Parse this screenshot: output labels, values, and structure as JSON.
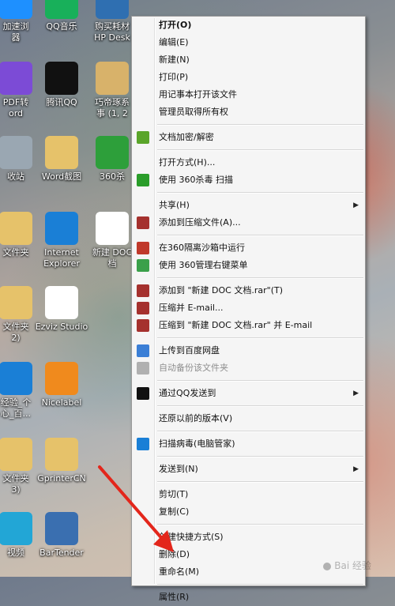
{
  "desktop": {
    "icons": [
      {
        "label": "加速浏\n器",
        "glyph": "#1e90ff"
      },
      {
        "label": "QQ音乐",
        "glyph": "#18b05a"
      },
      {
        "label": "购买耗材\nHP Desk",
        "glyph": "#2f6fb1"
      },
      {
        "label": "PDF转\nord",
        "glyph": "#7c4bd6"
      },
      {
        "label": "腾讯QQ",
        "glyph": "#111111"
      },
      {
        "label": "巧帝琢系\n事 (1, 2",
        "glyph": "#d8b26a"
      },
      {
        "label": "收站",
        "glyph": "#9aa7b2"
      },
      {
        "label": "Word截图",
        "glyph": "#e6c26a"
      },
      {
        "label": "360杀",
        "glyph": "#2d9f3a"
      },
      {
        "label": "文件夹",
        "glyph": "#e6c26a"
      },
      {
        "label": "Internet\nExplorer",
        "glyph": "#1a7fd6"
      },
      {
        "label": "新建 DOC\n档",
        "glyph": "#ffffff"
      },
      {
        "label": "文件夹\n2)",
        "glyph": "#e6c26a"
      },
      {
        "label": "Ezviz Studio",
        "glyph": "#ffffff"
      },
      {
        "label": "经验_个\n心_百...",
        "glyph": "#1a7fd6"
      },
      {
        "label": "Nicelabel",
        "glyph": "#f08a1d"
      },
      {
        "label": "文件夹\n3)",
        "glyph": "#e6c26a"
      },
      {
        "label": "GprinterCN",
        "glyph": "#e6c26a"
      },
      {
        "label": "视频",
        "glyph": "#22a6d6"
      },
      {
        "label": "BarTender",
        "glyph": "#3a6fb0"
      }
    ]
  },
  "context_menu": {
    "items": [
      {
        "type": "item",
        "label": "打开(O)",
        "bold": true,
        "icon": ""
      },
      {
        "type": "item",
        "label": "编辑(E)",
        "icon": ""
      },
      {
        "type": "item",
        "label": "新建(N)",
        "icon": ""
      },
      {
        "type": "item",
        "label": "打印(P)",
        "icon": ""
      },
      {
        "type": "item",
        "label": "用记事本打开该文件",
        "icon": ""
      },
      {
        "type": "item",
        "label": "管理员取得所有权",
        "icon": ""
      },
      {
        "type": "sep"
      },
      {
        "type": "item",
        "label": "文档加密/解密",
        "icon": "shield-lock-icon",
        "color": "#5aa52a"
      },
      {
        "type": "sep"
      },
      {
        "type": "item",
        "label": "打开方式(H)...",
        "icon": ""
      },
      {
        "type": "item",
        "label": "使用 360杀毒 扫描",
        "icon": "360-shield-icon",
        "color": "#2a9d2a"
      },
      {
        "type": "sep"
      },
      {
        "type": "item",
        "label": "共享(H)",
        "icon": "",
        "submenu": true
      },
      {
        "type": "item",
        "label": "添加到压缩文件(A)...",
        "icon": "winrar-icon",
        "color": "#a5312e"
      },
      {
        "type": "sep"
      },
      {
        "type": "item",
        "label": "在360隔离沙箱中运行",
        "icon": "sandbox-icon",
        "color": "#c0392b"
      },
      {
        "type": "item",
        "label": "使用 360管理右键菜单",
        "icon": "360-manage-icon",
        "color": "#3aa04a"
      },
      {
        "type": "sep"
      },
      {
        "type": "item",
        "label": "添加到 \"新建 DOC 文档.rar\"(T)",
        "icon": "winrar-icon",
        "color": "#a5312e"
      },
      {
        "type": "item",
        "label": "压缩并 E-mail...",
        "icon": "winrar-icon",
        "color": "#a5312e"
      },
      {
        "type": "item",
        "label": "压缩到 \"新建 DOC 文档.rar\" 并 E-mail",
        "icon": "winrar-icon",
        "color": "#a5312e"
      },
      {
        "type": "sep"
      },
      {
        "type": "item",
        "label": "上传到百度网盘",
        "icon": "baidu-cloud-icon",
        "color": "#3b7fd6"
      },
      {
        "type": "item",
        "label": "自动备份该文件夹",
        "icon": "baidu-backup-icon",
        "color": "#b0b0b0",
        "disabled": true
      },
      {
        "type": "sep"
      },
      {
        "type": "item",
        "label": "通过QQ发送到",
        "icon": "qq-icon",
        "color": "#111111",
        "submenu": true
      },
      {
        "type": "sep"
      },
      {
        "type": "item",
        "label": "还原以前的版本(V)",
        "icon": ""
      },
      {
        "type": "sep"
      },
      {
        "type": "item",
        "label": "扫描病毒(电脑管家)",
        "icon": "tencent-guard-icon",
        "color": "#1a7fd6"
      },
      {
        "type": "sep"
      },
      {
        "type": "item",
        "label": "发送到(N)",
        "icon": "",
        "submenu": true
      },
      {
        "type": "sep"
      },
      {
        "type": "item",
        "label": "剪切(T)",
        "icon": ""
      },
      {
        "type": "item",
        "label": "复制(C)",
        "icon": ""
      },
      {
        "type": "sep"
      },
      {
        "type": "item",
        "label": "创建快捷方式(S)",
        "icon": ""
      },
      {
        "type": "item",
        "label": "删除(D)",
        "icon": ""
      },
      {
        "type": "item",
        "label": "重命名(M)",
        "icon": ""
      },
      {
        "type": "sep"
      },
      {
        "type": "item",
        "label": "属性(R)",
        "icon": ""
      }
    ]
  },
  "annotation": {
    "arrow_color": "#e3261b"
  },
  "watermark": {
    "text": "Bai 经验"
  }
}
